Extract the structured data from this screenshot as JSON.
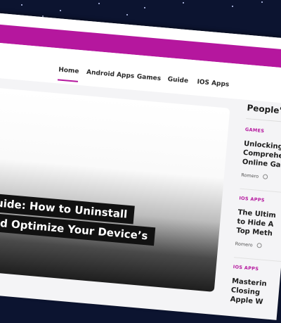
{
  "colors": {
    "brand": "#b5179e",
    "background": "#0c1430",
    "hero_bar": "#111111"
  },
  "nav": {
    "items": [
      {
        "label": "Home",
        "active": true
      },
      {
        "label": "Android Apps",
        "active": false
      },
      {
        "label": "Games",
        "active": false
      },
      {
        "label": "Guide",
        "active": false
      },
      {
        "label": "IOS Apps",
        "active": false
      }
    ]
  },
  "hero": {
    "title_lines": [
      "e Guide: How to Uninstall",
      "e and Optimize Your Device’s"
    ]
  },
  "sidebar": {
    "title": "People's",
    "articles": [
      {
        "category": "GAMES",
        "title_lines": [
          "Unlocking",
          "Comprehe",
          "Online Ga"
        ],
        "author": "Romero",
        "icon": "clock-icon"
      },
      {
        "category": "IOS APPS",
        "title_lines": [
          "The Ultim",
          "to Hide A",
          "Top Meth"
        ],
        "author": "Romero",
        "icon": "clock-icon"
      },
      {
        "category": "IOS APPS",
        "title_lines": [
          "Masterin",
          "Closing",
          "Apple W"
        ]
      }
    ]
  }
}
